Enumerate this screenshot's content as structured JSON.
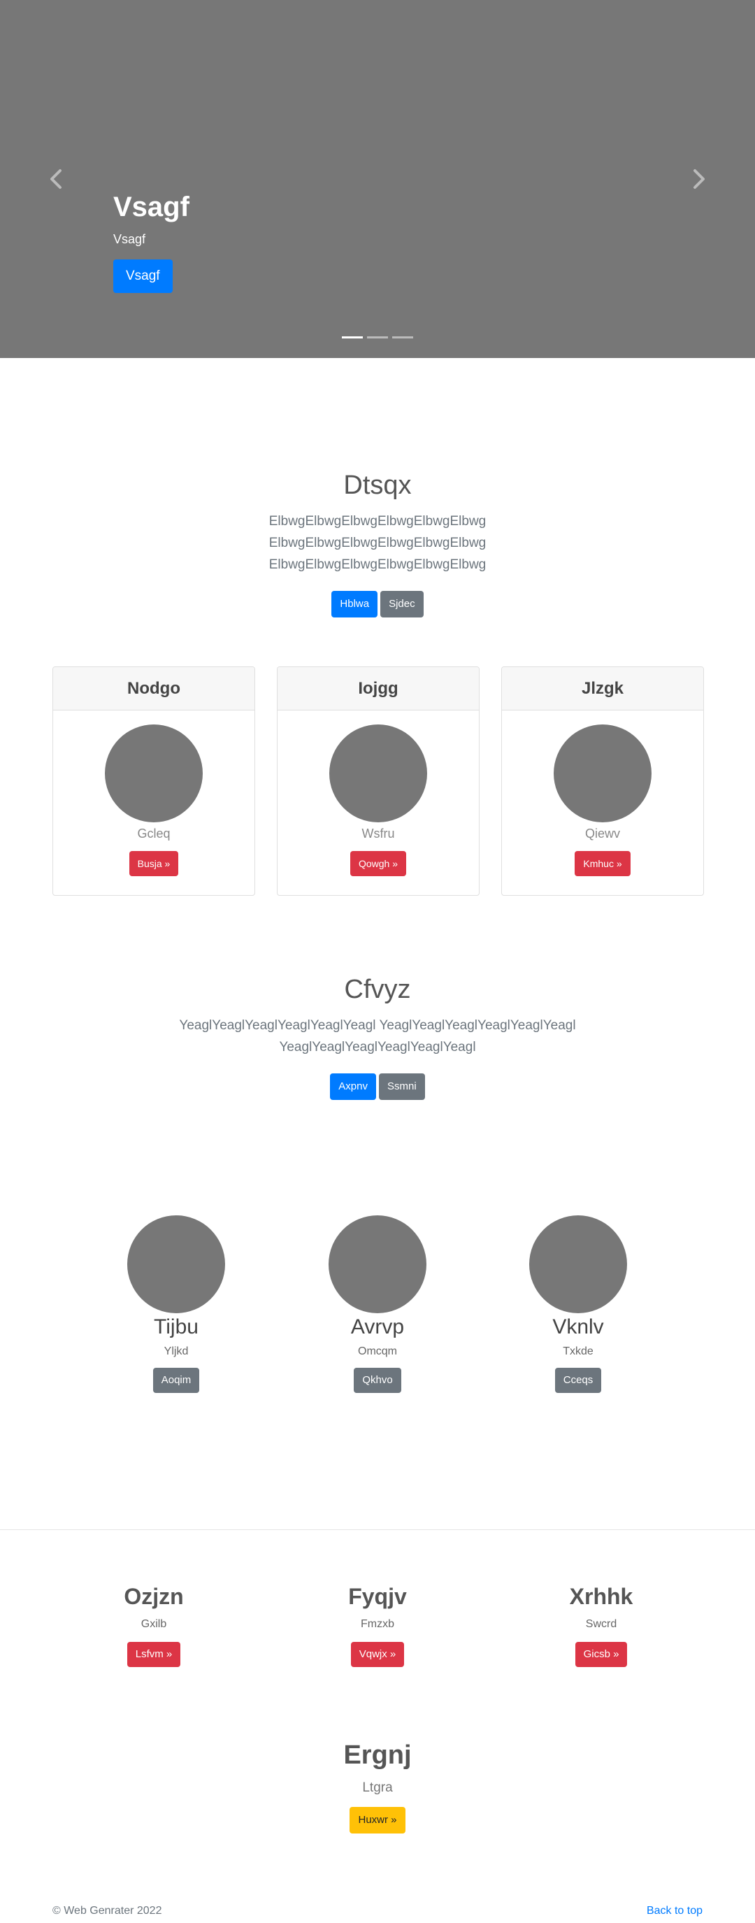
{
  "carousel": {
    "title": "Vsagf",
    "subtitle": "Vsagf",
    "button": "Vsagf",
    "indicator_count": 3
  },
  "section1": {
    "title": "Dtsqx",
    "lead": "ElbwgElbwgElbwgElbwgElbwgElbwg ElbwgElbwgElbwgElbwgElbwgElbwg ElbwgElbwgElbwgElbwgElbwgElbwg",
    "primary_button": "Hblwa",
    "secondary_button": "Sjdec"
  },
  "cards": [
    {
      "header": "Nodgo",
      "text": "Gcleq",
      "button": "Busja »"
    },
    {
      "header": "Iojgg",
      "text": "Wsfru",
      "button": "Qowgh »"
    },
    {
      "header": "Jlzgk",
      "text": "Qiewv",
      "button": "Kmhuc »"
    }
  ],
  "section2": {
    "title": "Cfvyz",
    "lead": "YeaglYeaglYeaglYeaglYeaglYeagl YeaglYeaglYeaglYeaglYeaglYeagl YeaglYeaglYeaglYeaglYeaglYeagl",
    "primary_button": "Axpnv",
    "secondary_button": "Ssmni"
  },
  "marketing": [
    {
      "title": "Tijbu",
      "text": "Yljkd",
      "button": "Aoqim"
    },
    {
      "title": "Avrvp",
      "text": "Omcqm",
      "button": "Qkhvo"
    },
    {
      "title": "Vknlv",
      "text": "Txkde",
      "button": "Cceqs"
    }
  ],
  "features": [
    {
      "title": "Ozjzn",
      "text": "Gxilb",
      "button": "Lsfvm »"
    },
    {
      "title": "Fyqjv",
      "text": "Fmzxb",
      "button": "Vqwjx »"
    },
    {
      "title": "Xrhhk",
      "text": "Swcrd",
      "button": "Gicsb »"
    }
  ],
  "single_feature": {
    "title": "Ergnj",
    "text": "Ltgra",
    "button": "Huxwr »"
  },
  "footer": {
    "copyright": "© Web Genrater 2022",
    "back_to_top": "Back to top"
  },
  "icons": {
    "prev": "chevron-left-icon",
    "next": "chevron-right-icon"
  },
  "colors": {
    "primary": "#007bff",
    "secondary": "#6c757d",
    "danger": "#dc3545",
    "warning": "#ffc107",
    "placeholder": "#777777"
  }
}
